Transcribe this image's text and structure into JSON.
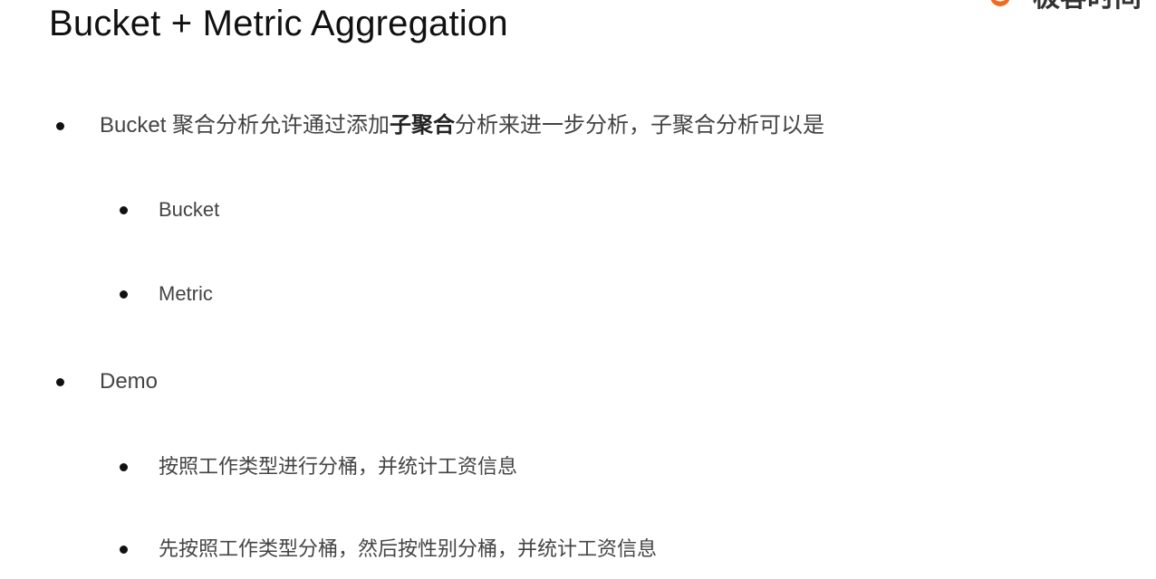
{
  "slide": {
    "title": "Bucket + Metric Aggregation",
    "logo_text": "极客时间"
  },
  "bullets": [
    {
      "level": 1,
      "pre": "Bucket 聚合分析允许通过添加",
      "strong": "子聚合",
      "post": "分析来进一步分析，子聚合分析可以是"
    },
    {
      "level": 2,
      "text": "Bucket"
    },
    {
      "level": 2,
      "text": "Metric"
    },
    {
      "level": 1,
      "text": "Demo"
    },
    {
      "level": 2,
      "text": "按照工作类型进行分桶，并统计工资信息"
    },
    {
      "level": 2,
      "text": "先按照工作类型分桶，然后按性别分桶，并统计工资信息"
    }
  ],
  "colors": {
    "logo_accent": "#f26b1d",
    "text": "#444444",
    "title": "#111111"
  },
  "icons": {
    "logo": "geektime-logo-icon"
  }
}
